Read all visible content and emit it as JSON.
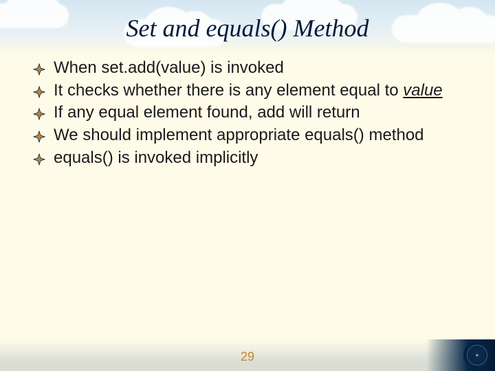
{
  "slide": {
    "title": "Set and equals() Method",
    "bullets": [
      {
        "text": "When set.add(value) is invoked"
      },
      {
        "pre": "It checks whether there is any element equal to ",
        "underlined": "value"
      },
      {
        "text": "If any equal element found, add will return"
      },
      {
        "text": "We should implement appropriate equals() method"
      },
      {
        "text": "equals() is invoked implicitly"
      }
    ],
    "page_number": "29"
  }
}
